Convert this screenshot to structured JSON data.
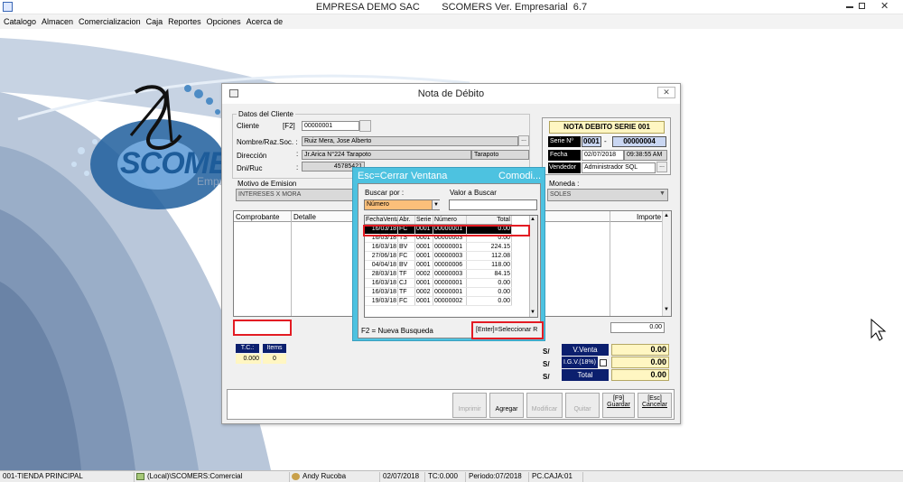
{
  "app": {
    "title": "EMPRESA DEMO SAC        SCOMERS Ver. Empresarial  6.7"
  },
  "menu": [
    "Catalogo",
    "Almacen",
    "Comercializacion",
    "Caja",
    "Reportes",
    "Opciones",
    "Acerca de"
  ],
  "logo": {
    "text": "SCOMERS",
    "sub": "Empre"
  },
  "dialog": {
    "title": "Nota de Débito",
    "section_client": "Datos del Cliente",
    "cliente_label": "Cliente",
    "f2_label": "[F2]",
    "cliente_value": "00000001",
    "nombre_label": "Nombre/Raz.Soc. :",
    "nombre_value": "Ruiz Mera, Jose Alberto",
    "direccion_label": "Dirección",
    "direccion_value": "Jr.Arica N°224 Tarapoto",
    "ciudad_value": "Tarapoto",
    "dni_label": "Dni/Ruc",
    "dni_value": "45785421",
    "motivo_label": "Motivo de Emision",
    "motivo_value": "INTERESES X MORA",
    "moneda_label": "Moneda :",
    "moneda_value": "SOLES",
    "doc_header": "NOTA DEBITO SERIE 001",
    "serie_label": "Serie Nº",
    "serie_value": "0001",
    "numero_value": "00000004",
    "fecha_label": "Fecha",
    "fecha_value": "02/07/2018",
    "hora_value": "09:38:55 AM",
    "vendedor_label": "Vendedor",
    "vendedor_value": "Administrador SQL",
    "grid_headers": [
      "Comprobante",
      "Detalle",
      "Importe"
    ],
    "subtotal_value": "0.00",
    "tc_label": "T.C.:",
    "tc_value": "0.000",
    "items_label": "Items",
    "items_value": "0",
    "currency_symbol": "S/",
    "vventa_label": "V.Venta",
    "vventa_value": "0.00",
    "igv_label": "I.G.V.(18%)",
    "igv_value": "0.00",
    "total_label": "Total",
    "total_value": "0.00",
    "buttons": {
      "imprimir": "Imprimir",
      "agregar": "Agregar",
      "modificar": "Modificar",
      "quitar": "Quitar",
      "guardar_key": "[F9]",
      "guardar": "Guardar",
      "cancelar_key": "[Esc]",
      "cancelar": "Cancelar"
    }
  },
  "popup": {
    "title": "Esc=Cerrar Ventana",
    "title_right": "Comodi...",
    "buscar_label": "Buscar por :",
    "valor_label": "Valor a Buscar",
    "buscar_value": "Número",
    "headers": [
      "FechaVenta",
      "Abr.",
      "Serie",
      "Número",
      "Total"
    ],
    "rows": [
      [
        "16/03/18",
        "FC",
        "0001",
        "00000001",
        "0.00"
      ],
      [
        "16/03/18",
        "TS",
        "0001",
        "00000003",
        "0.00"
      ],
      [
        "16/03/18",
        "BV",
        "0001",
        "00000001",
        "224.15"
      ],
      [
        "27/06/18",
        "FC",
        "0001",
        "00000003",
        "112.08"
      ],
      [
        "04/04/18",
        "BV",
        "0001",
        "00000006",
        "118.00"
      ],
      [
        "28/03/18",
        "TF",
        "0002",
        "00000003",
        "84.15"
      ],
      [
        "16/03/18",
        "CJ",
        "0001",
        "00000001",
        "0.00"
      ],
      [
        "16/03/18",
        "TF",
        "0002",
        "00000001",
        "0.00"
      ],
      [
        "19/03/18",
        "FC",
        "0001",
        "00000002",
        "0.00"
      ]
    ],
    "footer_left": "F2 = Nueva Busqueda",
    "footer_right": "[Enter]=Seleccionar R"
  },
  "status": [
    "001-TIENDA PRINCIPAL",
    "(Local)\\SCOMERS:Comercial",
    "Andy Rucoba",
    "02/07/2018",
    "TC:0.000",
    "Periodo:07/2018",
    "PC.CAJA:01"
  ],
  "colors": {
    "popup_bg": "#4dc2e0",
    "navy": "#0b1f6e",
    "yellow": "#fff6c2",
    "highlight_red": "#e31b23",
    "header_blue": "#c9d6f2"
  }
}
